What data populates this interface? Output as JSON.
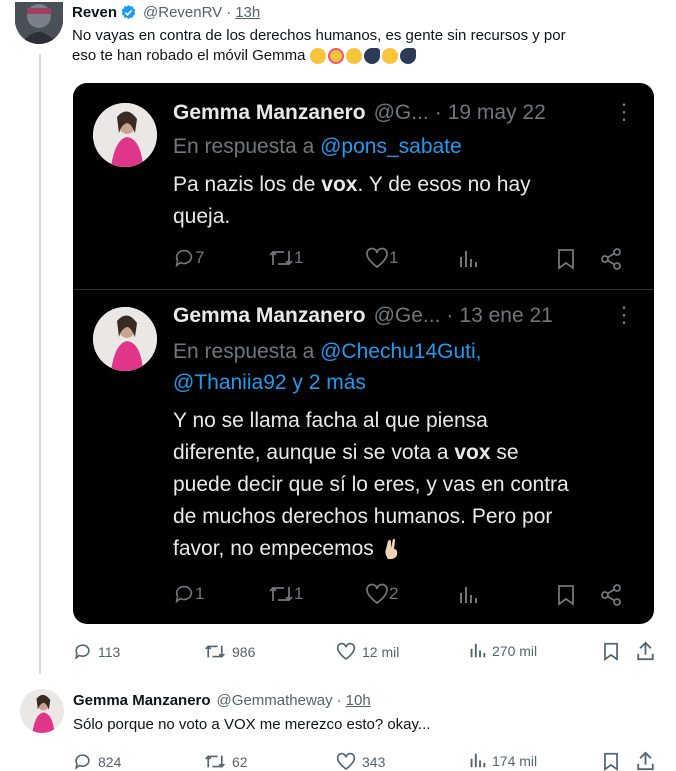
{
  "main_tweet": {
    "name": "Reven",
    "handle": "@RevenRV",
    "time": "13h",
    "text_line1": "No vayas en contra de los derechos humanos, es gente sin recursos y por",
    "text_line2": "eso te han robado el móvil Gemma",
    "emojis": [
      "face-with-hand-over-mouth",
      "smiling-face-with-hearts",
      "face-with-hand-over-mouth",
      "speaking-head",
      "face-with-hand-over-mouth",
      "speaking-head"
    ],
    "actions": {
      "replies": "113",
      "retweets": "986",
      "likes": "12 mil",
      "views": "270 mil"
    }
  },
  "quoted_thread": [
    {
      "name": "Gemma Manzanero",
      "handle": "@G...",
      "time": "19 may 22",
      "reply_prefix": "En respuesta a",
      "reply_to_line1": "@pons_sabate",
      "reply_to_line2": "",
      "body_lines": [
        "Pa nazis los de ",
        "vox",
        ". Y de esos no hay",
        "queja."
      ],
      "actions": {
        "replies": "7",
        "retweets": "1",
        "likes": "1"
      }
    },
    {
      "name": "Gemma Manzanero",
      "handle": "@Ge...",
      "time": "13 ene 21",
      "reply_prefix": "En respuesta a",
      "reply_to_line1": "@Chechu14Guti,",
      "reply_to_line2": "@Thaniia92 y 2 más",
      "body_lines": [
        "Y no se llama facha al que piensa",
        "diferente, aunque si se vota a ",
        "vox",
        " se",
        "puede decir que sí lo eres, y vas en contra",
        "de muchos derechos humanos. Pero por",
        "favor, no empecemos"
      ],
      "actions": {
        "replies": "1",
        "retweets": "1",
        "likes": "2"
      }
    }
  ],
  "reply_tweet": {
    "name": "Gemma Manzanero",
    "handle": "@Gemmatheway",
    "time": "10h",
    "text": "Sólo porque no voto a VOX me merezco esto? okay...",
    "actions": {
      "replies": "824",
      "retweets": "62",
      "likes": "343",
      "views": "174 mil"
    }
  },
  "separator": "·",
  "more_glyph": "⋮",
  "colors": {
    "accent": "#1d9bf0",
    "verified": "#1d9bf0",
    "card_bg": "#000000"
  }
}
